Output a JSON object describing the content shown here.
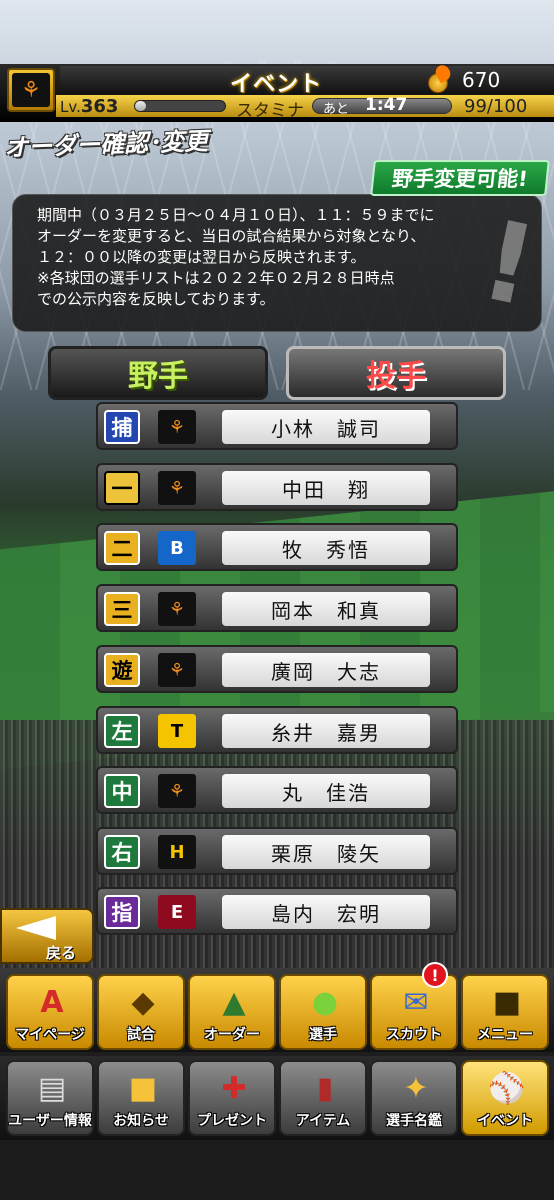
{
  "header": {
    "title": "イベント",
    "coins": "670",
    "level_label": "Lv.",
    "level": "363",
    "stamina_label": "スタミナ",
    "stamina_ato": "あと",
    "stamina_timer": "1:47",
    "stamina_value": "99/100",
    "team_icon": "giants-logo"
  },
  "page": {
    "title": "オーダー確認･変更",
    "badge": "野手変更可能!",
    "info_lines": [
      "期間中（０３月２５日〜０４月１０日）、１１：５９までに",
      "オーダーを変更すると、当日の試合結果から対象となり、",
      "１２：００以降の変更は翌日から反映されます。",
      "※各球団の選手リストは２０２２年０２月２８日時点",
      "での公示内容を反映しております。"
    ]
  },
  "tabs": {
    "fielders": "野手",
    "pitchers": "投手"
  },
  "lineup": [
    {
      "pos": "捕",
      "team": "G",
      "name": "小林　誠司"
    },
    {
      "pos": "一",
      "team": "G",
      "name": "中田　翔"
    },
    {
      "pos": "二",
      "team": "B",
      "name": "牧　秀悟"
    },
    {
      "pos": "三",
      "team": "G",
      "name": "岡本　和真"
    },
    {
      "pos": "遊",
      "team": "G",
      "name": "廣岡　大志"
    },
    {
      "pos": "左",
      "team": "T",
      "name": "糸井　嘉男"
    },
    {
      "pos": "中",
      "team": "G",
      "name": "丸　佳浩"
    },
    {
      "pos": "右",
      "team": "H",
      "name": "栗原　陵矢"
    },
    {
      "pos": "指",
      "team": "E",
      "name": "島内　宏明"
    }
  ],
  "back_label": "戻る",
  "nav_top": [
    {
      "label": "マイページ",
      "icon": "A"
    },
    {
      "label": "試合",
      "icon": "◆"
    },
    {
      "label": "オーダー",
      "icon": "▲"
    },
    {
      "label": "選手",
      "icon": "●"
    },
    {
      "label": "スカウト",
      "icon": "✉"
    },
    {
      "label": "メニュー",
      "icon": "■"
    }
  ],
  "nav_badge": "!",
  "nav_bottom": [
    {
      "label": "ユーザー情報",
      "icon": "▤"
    },
    {
      "label": "お知らせ",
      "icon": "■"
    },
    {
      "label": "プレゼント",
      "icon": "✚"
    },
    {
      "label": "アイテム",
      "icon": "▮"
    },
    {
      "label": "選手名鑑",
      "icon": "✦"
    },
    {
      "label": "イベント",
      "icon": "⚾"
    }
  ]
}
